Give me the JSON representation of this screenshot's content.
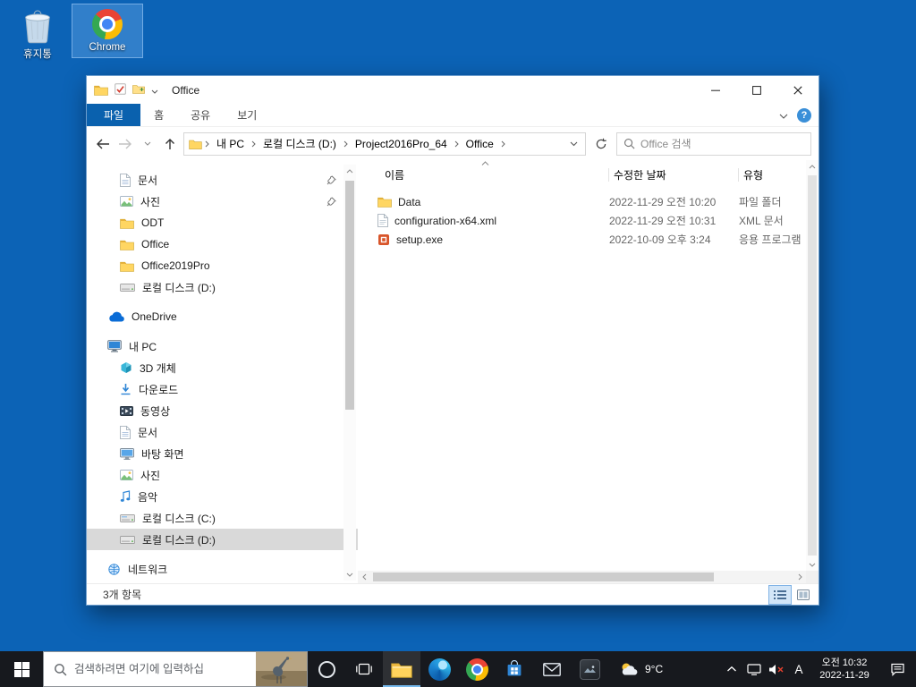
{
  "theme": {
    "desktop_bg": "#0c63b6",
    "taskbar_bg": "#17191e",
    "accent": "#0c64b4",
    "file_tab_bg": "#0a61ae",
    "sidebar_selected_bg": "#d9d9d9",
    "taskbar_active_underline": "#76b9ed"
  },
  "desktop": {
    "icons": [
      {
        "label": "휴지통",
        "icon": "recycle-bin-icon"
      },
      {
        "label": "Chrome",
        "icon": "chrome-icon"
      }
    ]
  },
  "explorer": {
    "title": "Office",
    "ribbon": {
      "file_tab": "파일",
      "tabs": [
        {
          "label": "홈"
        },
        {
          "label": "공유"
        },
        {
          "label": "보기"
        }
      ],
      "help_label": "?"
    },
    "navigation": {
      "breadcrumb": [
        {
          "label": "내 PC"
        },
        {
          "label": "로컬 디스크 (D:)"
        },
        {
          "label": "Project2016Pro_64"
        },
        {
          "label": "Office"
        }
      ]
    },
    "search": {
      "placeholder": "Office 검색"
    },
    "sidebar": {
      "quick": [
        {
          "label": "문서",
          "icon": "documents-icon",
          "pinned": true
        },
        {
          "label": "사진",
          "icon": "pictures-icon",
          "pinned": true
        },
        {
          "label": "ODT",
          "icon": "folder-icon"
        },
        {
          "label": "Office",
          "icon": "folder-icon"
        },
        {
          "label": "Office2019Pro",
          "icon": "folder-icon"
        },
        {
          "label": "로컬 디스크 (D:)",
          "icon": "drive-icon"
        }
      ],
      "onedrive_label": "OneDrive",
      "pc_label": "내 PC",
      "pc_children": [
        {
          "label": "3D 개체",
          "icon": "3d-objects-icon"
        },
        {
          "label": "다운로드",
          "icon": "downloads-icon"
        },
        {
          "label": "동영상",
          "icon": "videos-icon"
        },
        {
          "label": "문서",
          "icon": "documents-icon"
        },
        {
          "label": "바탕 화면",
          "icon": "desktop-icon"
        },
        {
          "label": "사진",
          "icon": "pictures-icon"
        },
        {
          "label": "음악",
          "icon": "music-icon"
        },
        {
          "label": "로컬 디스크 (C:)",
          "icon": "drive-icon"
        },
        {
          "label": "로컬 디스크 (D:)",
          "icon": "drive-icon",
          "selected": true
        }
      ],
      "network_label": "네트워크"
    },
    "list": {
      "columns": [
        "이름",
        "수정한 날짜",
        "유형"
      ],
      "rows": [
        {
          "name": "Data",
          "modified": "2022-11-29 오전 10:20",
          "type": "파일 폴더",
          "icon": "folder-icon"
        },
        {
          "name": "configuration-x64.xml",
          "modified": "2022-11-29 오전 10:31",
          "type": "XML 문서",
          "icon": "xml-file-icon"
        },
        {
          "name": "setup.exe",
          "modified": "2022-10-09 오후 3:24",
          "type": "응용 프로그램",
          "icon": "setup-exe-icon"
        }
      ]
    },
    "statusbar": {
      "count": "3개 항목"
    }
  },
  "taskbar": {
    "search_placeholder": "검색하려면 여기에 입력하십",
    "weather_temp": "9°C",
    "ime": "A",
    "time": "오전 10:32",
    "date": "2022-11-29"
  }
}
